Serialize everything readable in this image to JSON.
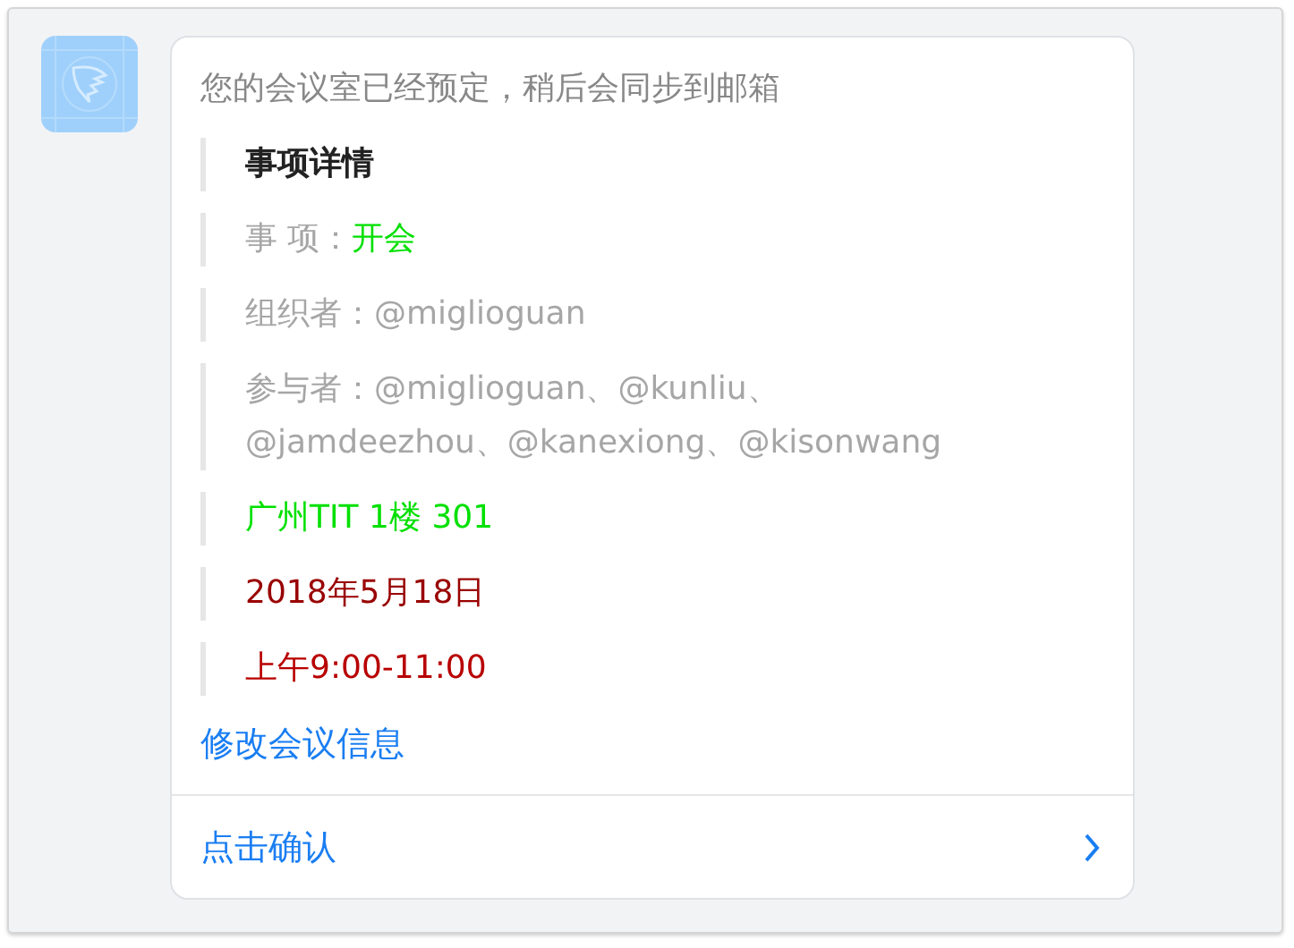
{
  "message": {
    "header": "您的会议室已经预定，稍后会同步到邮箱",
    "details": [
      {
        "kind": "title",
        "text": "事项详情"
      },
      {
        "kind": "field",
        "label": "事 项：",
        "value": "开会",
        "color": "#00e000"
      },
      {
        "kind": "field",
        "label": "组织者：",
        "value": "@miglioguan"
      },
      {
        "kind": "field",
        "label": "参与者：",
        "value": "@miglioguan、@kunliu、@jamdeezhou、@kanexiong、@kisonwang"
      },
      {
        "kind": "text",
        "text": "广州TIT 1楼 301",
        "color": "#00e000"
      },
      {
        "kind": "text",
        "text": "2018年5月18日",
        "color": "#990000"
      },
      {
        "kind": "text",
        "text": "上午9:00-11:00",
        "color": "#b80000"
      }
    ],
    "link": "修改会议信息",
    "action": "点击确认"
  }
}
